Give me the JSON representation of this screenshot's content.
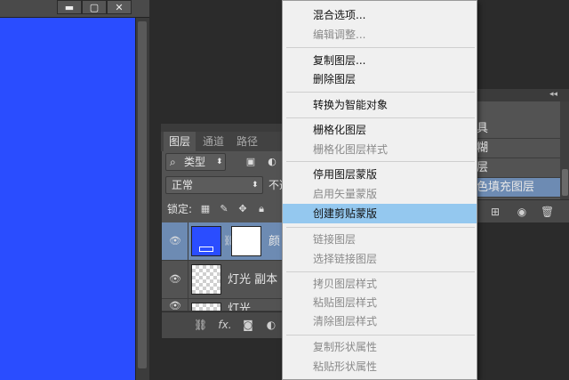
{
  "document_window": {
    "buttons": [
      {
        "name": "minimize-button",
        "symbol": "▬"
      },
      {
        "name": "maximize-button",
        "symbol": "▢"
      },
      {
        "name": "close-button",
        "symbol": "✕"
      }
    ],
    "canvas_color": "#2a4dff"
  },
  "layers_panel": {
    "tabs": [
      "图层",
      "通道",
      "路径"
    ],
    "filter_label": "类型",
    "blend_mode": "正常",
    "opacity_label_partial": "不透",
    "lock_label": "锁定:",
    "layers": [
      {
        "name": "颜",
        "selected": true
      },
      {
        "name": "灯光 副本",
        "selected": false
      },
      {
        "name": "灯光",
        "selected": false
      }
    ],
    "bottom_icons": [
      "link-icon",
      "fx-icon",
      "mask-icon",
      "adjustment-icon"
    ],
    "bottom_labels": {
      "fx": "fx."
    }
  },
  "right_panel": {
    "items": [
      "具",
      "糊",
      "层",
      "色填充图层"
    ],
    "selected_index": 3
  },
  "context_menu": {
    "items": [
      {
        "label": "混合选项...",
        "disabled": false
      },
      {
        "label": "编辑调整...",
        "disabled": true
      },
      {
        "label": "复制图层...",
        "disabled": false
      },
      {
        "label": "删除图层",
        "disabled": false
      },
      {
        "label": "转换为智能对象",
        "disabled": false
      },
      {
        "label": "栅格化图层",
        "disabled": false
      },
      {
        "label": "栅格化图层样式",
        "disabled": true
      },
      {
        "label": "停用图层蒙版",
        "disabled": false
      },
      {
        "label": "启用矢量蒙版",
        "disabled": true
      },
      {
        "label": "创建剪贴蒙版",
        "disabled": false,
        "highlighted": true
      },
      {
        "label": "链接图层",
        "disabled": true
      },
      {
        "label": "选择链接图层",
        "disabled": true
      },
      {
        "label": "拷贝图层样式",
        "disabled": true
      },
      {
        "label": "粘贴图层样式",
        "disabled": true
      },
      {
        "label": "清除图层样式",
        "disabled": true
      },
      {
        "label": "复制形状属性",
        "disabled": true
      },
      {
        "label": "粘贴形状属性",
        "disabled": true
      }
    ]
  }
}
